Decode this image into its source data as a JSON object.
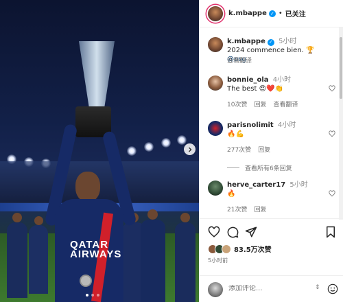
{
  "post": {
    "author": "k.mbappe",
    "follow_state": "已关注",
    "caption_text": "2024 commence bien.",
    "caption_emoji": "🏆",
    "caption_mention": "@psg",
    "caption_time": "5小时",
    "see_translation": "查看翻译",
    "shirt_text": "QATAR AIRWAYS",
    "likes": "83.5万次赞",
    "time_ago": "5小时前",
    "comment_placeholder": "添加评论..."
  },
  "comments": [
    {
      "user": "bonnie_ola",
      "time": "4小时",
      "text": "The best 😍❤️👏",
      "likes": "10次赞",
      "reply": "回复",
      "translate": "查看翻译"
    },
    {
      "user": "parisnolimit",
      "time": "4小时",
      "text": "🔥💪",
      "likes": "277次赞",
      "reply": "回复"
    },
    {
      "user": "herve_carter17",
      "time": "5小时",
      "text": "🔥",
      "likes": "21次赞",
      "reply": "回复"
    }
  ],
  "view_replies": "查看所有6条回复",
  "colors": {
    "verified": "#0095f6",
    "story_ring": "#e1306c",
    "jersey": "#162a66",
    "jersey_stripe": "#d0202a"
  },
  "icons": [
    "verified-icon",
    "heart-icon",
    "comment-icon",
    "share-icon",
    "save-icon",
    "emoji-icon",
    "chevron-right-icon"
  ]
}
